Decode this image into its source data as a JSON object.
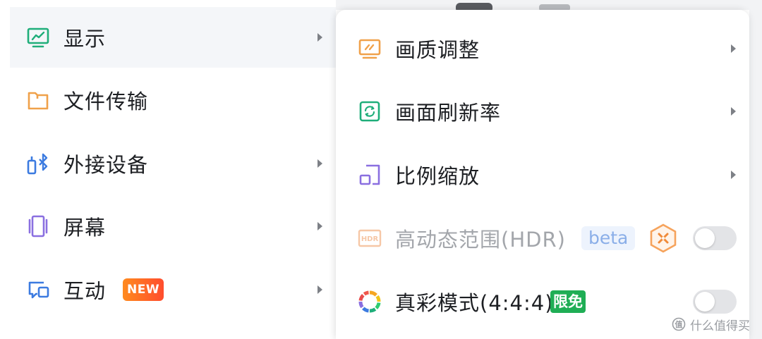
{
  "main_menu": {
    "items": [
      {
        "label": "显示",
        "active": true,
        "has_submenu": true,
        "icon": "monitor-icon"
      },
      {
        "label": "文件传输",
        "active": false,
        "has_submenu": false,
        "icon": "folder-icon"
      },
      {
        "label": "外接设备",
        "active": false,
        "has_submenu": true,
        "icon": "bluetooth-device-icon"
      },
      {
        "label": "屏幕",
        "active": false,
        "has_submenu": true,
        "icon": "screen-icon"
      },
      {
        "label": "互动",
        "active": false,
        "has_submenu": true,
        "icon": "interaction-icon",
        "badge": "NEW"
      }
    ]
  },
  "sub_menu": {
    "items": [
      {
        "label": "画质调整",
        "has_submenu": true,
        "icon": "picture-quality-icon"
      },
      {
        "label": "画面刷新率",
        "has_submenu": true,
        "icon": "refresh-rate-icon"
      },
      {
        "label": "比例缩放",
        "has_submenu": true,
        "icon": "scale-icon"
      },
      {
        "label": "高动态范围(HDR)",
        "disabled": true,
        "badge": "beta",
        "icon": "hdr-icon",
        "vip_icon": "vip-badge-icon",
        "toggle_on": false
      },
      {
        "label": "真彩模式(4:4:4)",
        "badge": "限免",
        "icon": "true-color-icon",
        "toggle_on": false
      }
    ]
  },
  "watermark": {
    "text": "什么值得买",
    "icon": "smzdm-logo-icon"
  },
  "colors": {
    "green": "#1fae7a",
    "orange": "#f0a14a",
    "blue": "#3c7be0",
    "purple": "#8a6fe0",
    "badge_new": "#ff5a2c",
    "badge_free": "#1fae55",
    "active_bg": "#f4f6f9"
  }
}
